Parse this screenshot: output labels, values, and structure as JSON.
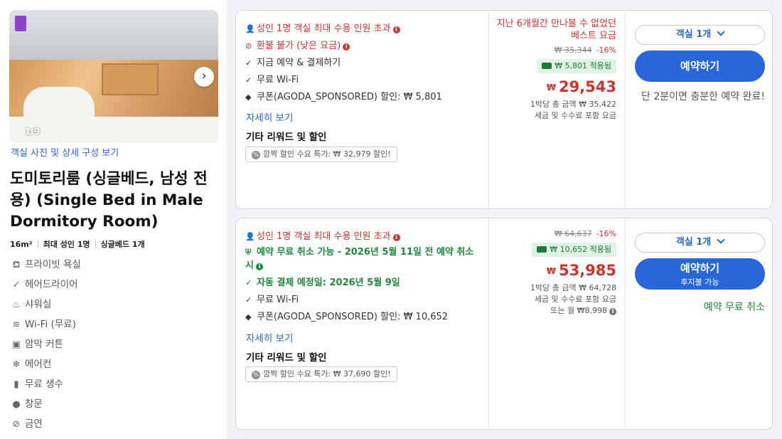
{
  "room": {
    "photo_counter": "1/9",
    "photo_link": "객실 사진 및 상세 구성 보기",
    "title": "도미토리룸 (싱글베드, 남성 전용) (Single Bed in Male Dormitory Room)",
    "specs": [
      "16m²",
      "최대 성인 1명",
      "싱글베드 1개"
    ],
    "amenities": [
      {
        "icon": "toilet-icon",
        "glyph": "⛾",
        "label": "프라이빗 욕실"
      },
      {
        "icon": "check-icon",
        "glyph": "✓",
        "label": "헤어드라이어"
      },
      {
        "icon": "shower-icon",
        "glyph": "♨",
        "label": "샤워실"
      },
      {
        "icon": "wifi-icon",
        "glyph": "≋",
        "label": "Wi-Fi (무료)"
      },
      {
        "icon": "blackout-curtain-icon",
        "glyph": "▣",
        "label": "암막 커튼"
      },
      {
        "icon": "aircon-icon",
        "glyph": "❄",
        "label": "에어컨"
      },
      {
        "icon": "water-bottle-icon",
        "glyph": "▮",
        "label": "무료 생수"
      },
      {
        "icon": "window-icon",
        "glyph": "●",
        "label": "창문"
      },
      {
        "icon": "no-smoking-icon",
        "glyph": "⊘",
        "label": "금연"
      }
    ]
  },
  "offers": [
    {
      "occupancy_warning": "성인 1명 객실 최대 수용 인원 초과",
      "policy": "환불 불가 (낮은 요금)",
      "features": [
        "지금 예약 & 결제하기",
        "무료 Wi-Fi"
      ],
      "coupon": "쿠폰(AGODA_SPONSORED) 할인: ₩ 5,801",
      "more_link": "자세히 보기",
      "other_rewards": "기타 리워드 및 할인",
      "promo": "깜짝 할인 수요 특가: ₩ 32,979 할인!",
      "best_rate": "지난 6개월간 만나볼 수 없었던 베스트 요금",
      "original_price": "₩ 35,344",
      "discount_pct": "-16%",
      "applied": "₩ 5,801 적용됨",
      "currency": "₩",
      "price": "29,543",
      "total_line": "1박당 총 금액 ₩ 35,422",
      "tax_line": "세금 및 수수료 포함 요금",
      "room_select": "객실 1개",
      "book_label": "예약하기",
      "note": "단 2분이면 충분한 예약 완료!"
    },
    {
      "occupancy_warning": "성인 1명 객실 최대 수용 인원 초과",
      "free_cancel": "예약 무료 취소 가능 - 2026년 5월 11일 전 예약 취소 시",
      "auto_pay": "자동 결제 예정일: 2026년 5월 9일",
      "features": [
        "무료 Wi-Fi"
      ],
      "coupon": "쿠폰(AGODA_SPONSORED) 할인: ₩ 10,652",
      "more_link": "자세히 보기",
      "other_rewards": "기타 리워드 및 할인",
      "promo": "깜짝 할인 수요 특가: ₩ 37,690 할인!",
      "original_price": "₩ 64,637",
      "discount_pct": "-16%",
      "applied": "₩ 10,652 적용됨",
      "currency": "₩",
      "price": "53,985",
      "total_line": "1박당 총 금액 ₩ 64,728",
      "tax_line": "세금 및 수수료 포함 요금",
      "monthly_line": "또는 월 ₩8,998",
      "room_select": "객실 1개",
      "book_label": "예약하기",
      "book_sub": "후지불 가능",
      "note": "예약 무료 취소"
    }
  ],
  "colors": {
    "accent": "#2867d9",
    "price_red": "#d0332b",
    "green": "#1e8a3a"
  }
}
